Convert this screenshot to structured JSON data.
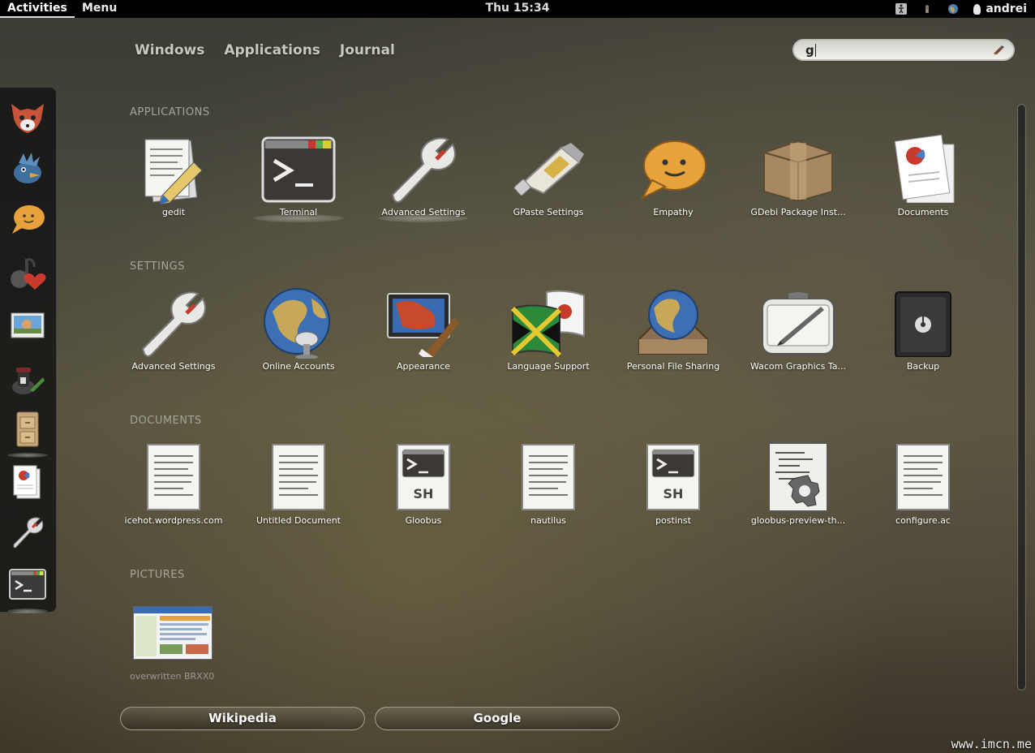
{
  "topbar": {
    "activities": "Activities",
    "menu": "Menu",
    "clock": "Thu 15:34",
    "user": "andrei"
  },
  "tabs": [
    "Windows",
    "Applications",
    "Journal"
  ],
  "search": {
    "value": "g"
  },
  "sections": {
    "applications": {
      "label": "APPLICATIONS",
      "items": [
        "gedit",
        "Terminal",
        "Advanced Settings",
        "GPaste Settings",
        "Empathy",
        "GDebi Package Inst...",
        "Documents"
      ]
    },
    "settings": {
      "label": "SETTINGS",
      "items": [
        "Advanced Settings",
        "Online Accounts",
        "Appearance",
        "Language Support",
        "Personal File Sharing",
        "Wacom Graphics Ta...",
        "Backup"
      ]
    },
    "documents": {
      "label": "DOCUMENTS",
      "items": [
        "icehot.wordpress.com",
        "Untitled Document",
        "Gloobus",
        "nautilus",
        "postinst",
        "gloobus-preview-th...",
        "configure.ac"
      ]
    },
    "pictures": {
      "label": "PICTURES",
      "items": [
        "overwritten BRXX0..."
      ]
    }
  },
  "providers": [
    "Wikipedia",
    "Google"
  ],
  "watermark": "www.imcn.me",
  "sh_label": "SH"
}
